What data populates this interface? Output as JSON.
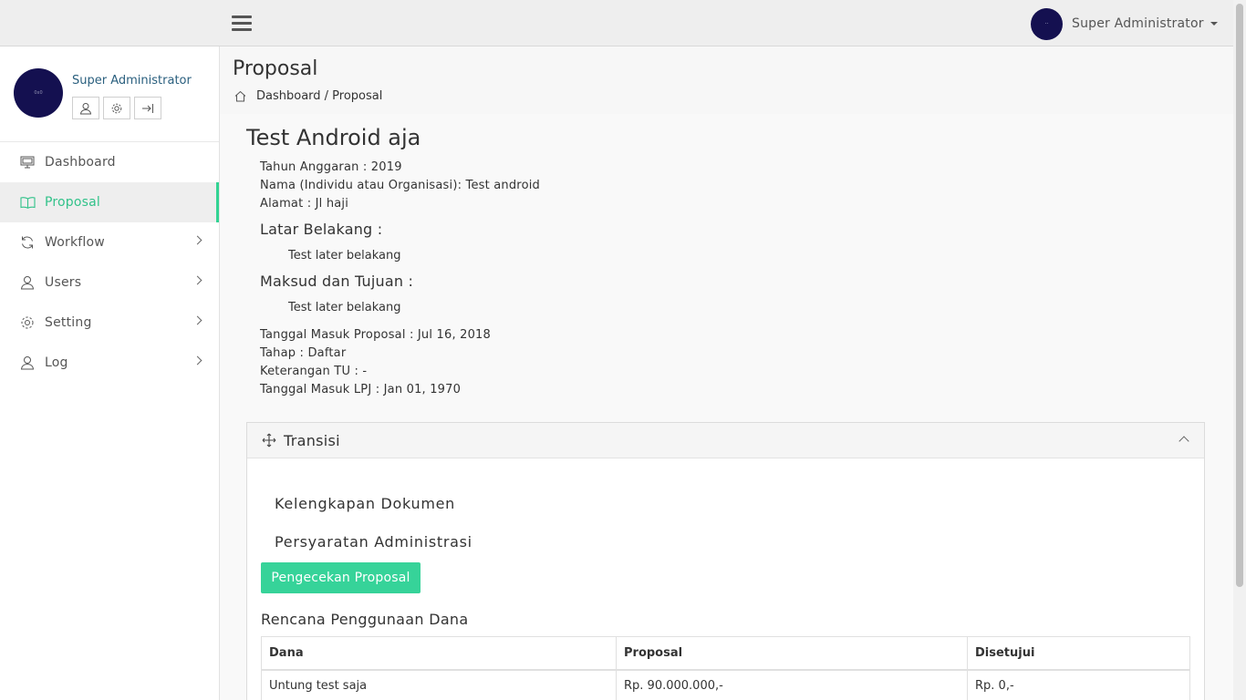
{
  "navbar": {
    "user_name": "Super Administrator",
    "avatar_text": "··",
    "icons": {
      "menu": "hamburger-icon",
      "caret": "caret-down-icon"
    }
  },
  "sidebar": {
    "profile": {
      "name": "Super Administrator",
      "avatar_text": "0x0",
      "buttons": [
        "user-icon",
        "gear-icon",
        "logout-icon"
      ]
    },
    "items": [
      {
        "label": "Dashboard",
        "icon": "monitor-icon"
      },
      {
        "label": "Proposal",
        "icon": "book-icon",
        "active": true
      },
      {
        "label": "Workflow",
        "icon": "refresh-icon",
        "has_children": true
      },
      {
        "label": "Users",
        "icon": "user-icon",
        "has_children": true
      },
      {
        "label": "Setting",
        "icon": "gear-icon",
        "has_children": true
      },
      {
        "label": "Log",
        "icon": "user-icon",
        "has_children": true
      }
    ]
  },
  "header": {
    "title": "Proposal",
    "breadcrumb": "Dashboard / Proposal"
  },
  "proposal": {
    "title": "Test Android aja",
    "tahun": "Tahun Anggaran : 2019",
    "nama": "Nama (Individu atau Organisasi): Test android",
    "alamat": "Alamat : Jl haji",
    "latar_title": "Latar Belakang :",
    "latar_body": "Test later belakang",
    "maksud_title": "Maksud dan Tujuan :",
    "maksud_body": "Test later belakang",
    "tanggal_masuk": "Tanggal Masuk Proposal : Jul 16, 2018",
    "tahap": "Tahap : Daftar",
    "keterangan": "Keterangan TU : -",
    "tanggal_lpj": "Tanggal Masuk LPJ : Jan 01, 1970"
  },
  "transisi": {
    "title": "Transisi",
    "kelengkapan": "Kelengkapan Dokumen",
    "persyaratan": "Persyaratan Administrasi",
    "button_label": "Pengecekan Proposal",
    "rencana_title": "Rencana Penggunaan Dana",
    "table": {
      "headers": [
        "Dana",
        "Proposal",
        "Disetujui"
      ],
      "rows": [
        [
          "Untung test saja",
          "Rp. 90.000.000,-",
          "Rp. 0,-"
        ]
      ]
    }
  },
  "colors": {
    "accent": "#36d399",
    "avatar": "#141050",
    "profile_name": "#2a5f7e"
  }
}
